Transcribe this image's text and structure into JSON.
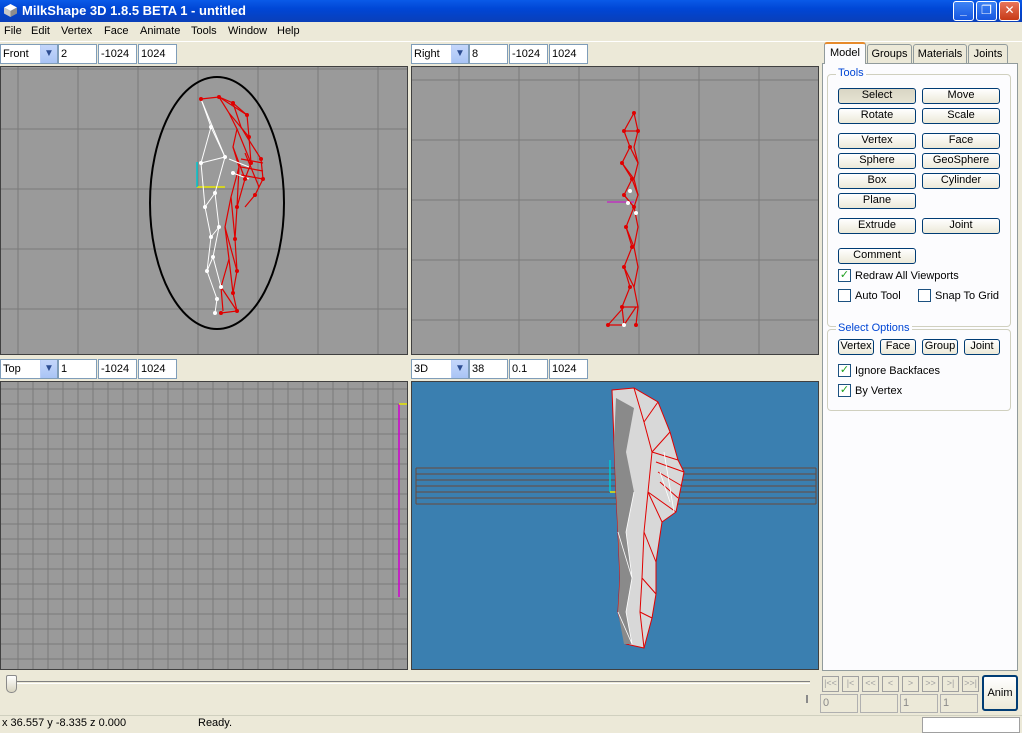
{
  "window": {
    "title": "MilkShape 3D 1.8.5 BETA 1 - untitled",
    "app_icon": "milkshape-cube-icon"
  },
  "menu": [
    "File",
    "Edit",
    "Vertex",
    "Face",
    "Animate",
    "Tools",
    "Window",
    "Help"
  ],
  "viewports": {
    "front": {
      "view": "Front",
      "zoom": "2",
      "min": "-1024",
      "max": "1024"
    },
    "right": {
      "view": "Right",
      "zoom": "8",
      "min": "-1024",
      "max": "1024"
    },
    "top": {
      "view": "Top",
      "zoom": "1",
      "min": "-1024",
      "max": "1024"
    },
    "three_d": {
      "view": "3D",
      "zoom": "38",
      "min": "0.1",
      "max": "1024"
    }
  },
  "tabs": [
    "Model",
    "Groups",
    "Materials",
    "Joints"
  ],
  "tools": {
    "title": "Tools",
    "select": "Select",
    "move": "Move",
    "rotate": "Rotate",
    "scale": "Scale",
    "vertex": "Vertex",
    "face": "Face",
    "sphere": "Sphere",
    "geosphere": "GeoSphere",
    "box": "Box",
    "cylinder": "Cylinder",
    "plane": "Plane",
    "extrude": "Extrude",
    "joint": "Joint",
    "comment": "Comment",
    "redraw_all": "Redraw All Viewports",
    "auto_tool": "Auto Tool",
    "snap_to_grid": "Snap To Grid"
  },
  "select_options": {
    "title": "Select Options",
    "vertex": "Vertex",
    "face": "Face",
    "group": "Group",
    "joint": "Joint",
    "ignore_backfaces": "Ignore Backfaces",
    "by_vertex": "By Vertex"
  },
  "timeline": {
    "buttons": [
      "|<<",
      "|<",
      "<<",
      "<",
      ">",
      ">>",
      ">|",
      ">>|"
    ],
    "frame_start": "0",
    "frame_current": "",
    "frame_min": "1",
    "frame_max": "1",
    "anim": "Anim"
  },
  "status": {
    "coords": "x 36.557 y -8.335 z 0.000",
    "message": "Ready."
  },
  "colors": {
    "viewport_gray": "#9a9a9a",
    "viewport_3d": "#3a7fb0",
    "mesh_red": "#e00000",
    "selected_white": "#ffffff"
  }
}
